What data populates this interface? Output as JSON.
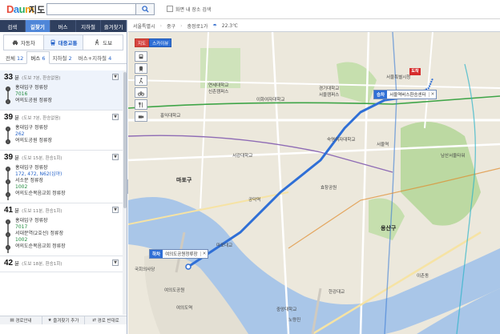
{
  "header": {
    "logo_text": "Daum",
    "service_name": "지도",
    "search_value": "",
    "search_placeholder": "",
    "checkbox_label": "화면 내 장소 검색"
  },
  "main_tabs": [
    {
      "label": "검색",
      "active": false
    },
    {
      "label": "길찾기",
      "active": true
    },
    {
      "label": "버스",
      "active": false
    },
    {
      "label": "지하철",
      "active": false
    },
    {
      "label": "즐겨찾기",
      "active": false
    }
  ],
  "modes": [
    {
      "label": "자동차",
      "icon": "car-icon",
      "active": false
    },
    {
      "label": "대중교통",
      "icon": "bus-icon",
      "active": true
    },
    {
      "label": "도보",
      "icon": "walk-icon",
      "active": false
    }
  ],
  "subtabs": [
    {
      "label": "전체",
      "count": "12",
      "active": false
    },
    {
      "label": "버스",
      "count": "6",
      "active": true
    },
    {
      "label": "지하철",
      "count": "2",
      "active": false
    },
    {
      "label": "버스+지하철",
      "count": "4",
      "active": false
    }
  ],
  "routes": [
    {
      "minutes": "33",
      "unit": "분",
      "meta": "(도보 7분, 환승없음)",
      "selected": true,
      "steps": [
        {
          "stop": "홍대입구 정류장",
          "bus": "7016",
          "bus_color": "green"
        },
        {
          "stop": "여의도공원 정류장",
          "bus": "",
          "bus_color": ""
        }
      ]
    },
    {
      "minutes": "39",
      "unit": "분",
      "meta": "(도보 7분, 환승없음)",
      "selected": false,
      "steps": [
        {
          "stop": "홍대입구 정류장",
          "bus": "262",
          "bus_color": "blue"
        },
        {
          "stop": "여의도공원 정류장",
          "bus": "",
          "bus_color": ""
        }
      ]
    },
    {
      "minutes": "39",
      "unit": "분",
      "meta": "(도보 15분, 환승1회)",
      "selected": false,
      "steps": [
        {
          "stop": "홍대입구 정류장",
          "bus": "172, 472, N62(심야)",
          "bus_color": "blue"
        },
        {
          "stop": "서소문 정류장",
          "bus": "1002",
          "bus_color": "green"
        },
        {
          "stop": "여의도순복음교회 정류장",
          "bus": "",
          "bus_color": ""
        }
      ]
    },
    {
      "minutes": "41",
      "unit": "분",
      "meta": "(도보 11분, 환승1회)",
      "selected": false,
      "steps": [
        {
          "stop": "홍대입구 정류장",
          "bus": "7017",
          "bus_color": "green"
        },
        {
          "stop": "서대문역(2호선) 정류장",
          "bus": "1002",
          "bus_color": "green"
        },
        {
          "stop": "여의도순복음교회 정류장",
          "bus": "",
          "bus_color": ""
        }
      ]
    },
    {
      "minutes": "42",
      "unit": "분",
      "meta": "(도보 18분, 환승1회)",
      "selected": false,
      "steps": []
    }
  ],
  "bottom_bar": [
    {
      "label": "경로안내",
      "icon": "print-icon"
    },
    {
      "label": "즐겨찾기 추가",
      "icon": "star-icon"
    },
    {
      "label": "경로 반대로",
      "icon": "reverse-icon"
    }
  ],
  "map_header": {
    "region": "서울특별시",
    "district": "중구",
    "dong": "충정로1가",
    "weather": "22.3℃"
  },
  "map_types": [
    {
      "label": "지도"
    },
    {
      "label": "스카이뷰"
    }
  ],
  "map_markers": {
    "destination_badge": "도착",
    "boarding_tag": "승차",
    "boarding_stop": "서울역버스환승센터",
    "alighting_tag": "하차",
    "alighting_stop": "여의도공원정류장"
  },
  "map_labels": [
    "서울특별시청",
    "연세대학교",
    "신촌캠퍼스",
    "홍익대학교",
    "서강대학교",
    "이화여자대학교",
    "경기대학교",
    "서울캠퍼스",
    "숙명여자대학교",
    "공덕역",
    "마포대교",
    "여의도공원",
    "여의도역",
    "국회의사당",
    "서울역",
    "남산서울타워",
    "용산구",
    "이촌동",
    "노량진",
    "중앙대학교",
    "효창공원",
    "한강대교",
    "마포구"
  ],
  "colors": {
    "nav_dark": "#2f3f5e",
    "accent_blue": "#4f86d8",
    "route_blue": "#2f6fd6",
    "river": "#a9c6e8",
    "park": "#bcd9a2"
  }
}
